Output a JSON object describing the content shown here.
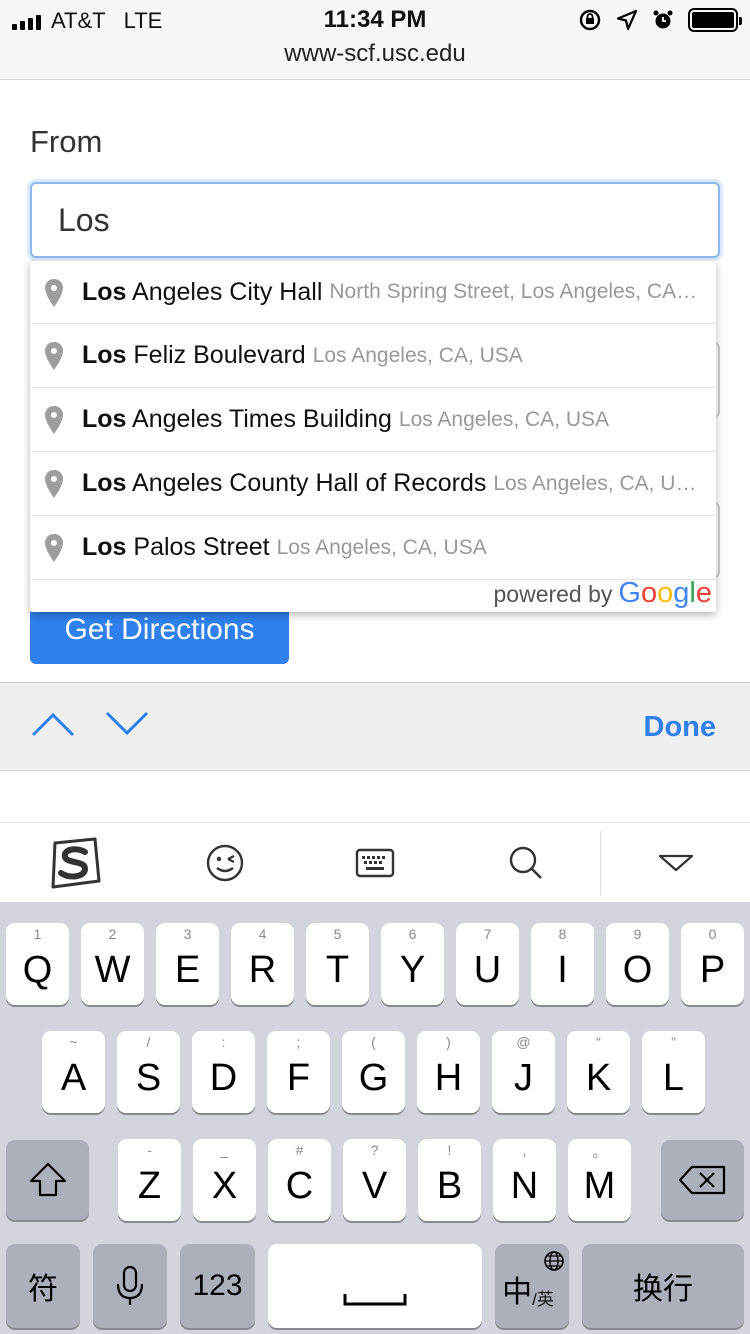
{
  "status_bar": {
    "carrier": "AT&T",
    "network": "LTE",
    "time": "11:34 PM",
    "url": "www-scf.usc.edu"
  },
  "form": {
    "from_label": "From",
    "from_value": "Los",
    "get_directions_label": "Get Directions"
  },
  "autocomplete": {
    "items": [
      {
        "match": "Los",
        "rest": " Angeles City Hall",
        "secondary": "North Spring Street, Los Angeles, CA, USA"
      },
      {
        "match": "Los",
        "rest": " Feliz Boulevard",
        "secondary": "Los Angeles, CA, USA"
      },
      {
        "match": "Los",
        "rest": " Angeles Times Building",
        "secondary": "Los Angeles, CA, USA"
      },
      {
        "match": "Los",
        "rest": " Angeles County Hall of Records",
        "secondary": "Los Angeles, CA, USA"
      },
      {
        "match": "Los",
        "rest": " Palos Street",
        "secondary": "Los Angeles, CA, USA"
      }
    ],
    "powered_by": "powered by",
    "google_letters": [
      "G",
      "o",
      "o",
      "g",
      "l",
      "e"
    ]
  },
  "accessory": {
    "done_label": "Done"
  },
  "keyboard": {
    "row1": [
      {
        "l": "Q",
        "s": "1"
      },
      {
        "l": "W",
        "s": "2"
      },
      {
        "l": "E",
        "s": "3"
      },
      {
        "l": "R",
        "s": "4"
      },
      {
        "l": "T",
        "s": "5"
      },
      {
        "l": "Y",
        "s": "6"
      },
      {
        "l": "U",
        "s": "7"
      },
      {
        "l": "I",
        "s": "8"
      },
      {
        "l": "O",
        "s": "9"
      },
      {
        "l": "P",
        "s": "0"
      }
    ],
    "row2": [
      {
        "l": "A",
        "s": "~"
      },
      {
        "l": "S",
        "s": "/"
      },
      {
        "l": "D",
        "s": ":"
      },
      {
        "l": "F",
        "s": ";"
      },
      {
        "l": "G",
        "s": "("
      },
      {
        "l": "H",
        "s": ")"
      },
      {
        "l": "J",
        "s": "@"
      },
      {
        "l": "K",
        "s": "“"
      },
      {
        "l": "L",
        "s": "”"
      }
    ],
    "row3": [
      {
        "l": "Z",
        "s": "-"
      },
      {
        "l": "X",
        "s": "_"
      },
      {
        "l": "C",
        "s": "#"
      },
      {
        "l": "V",
        "s": "?"
      },
      {
        "l": "B",
        "s": "!"
      },
      {
        "l": "N",
        "s": ","
      },
      {
        "l": "M",
        "s": "。"
      }
    ],
    "symbols_label": "符",
    "numbers_label": "123",
    "lang_main": "中",
    "lang_sub": "/英",
    "return_label": "换行"
  }
}
